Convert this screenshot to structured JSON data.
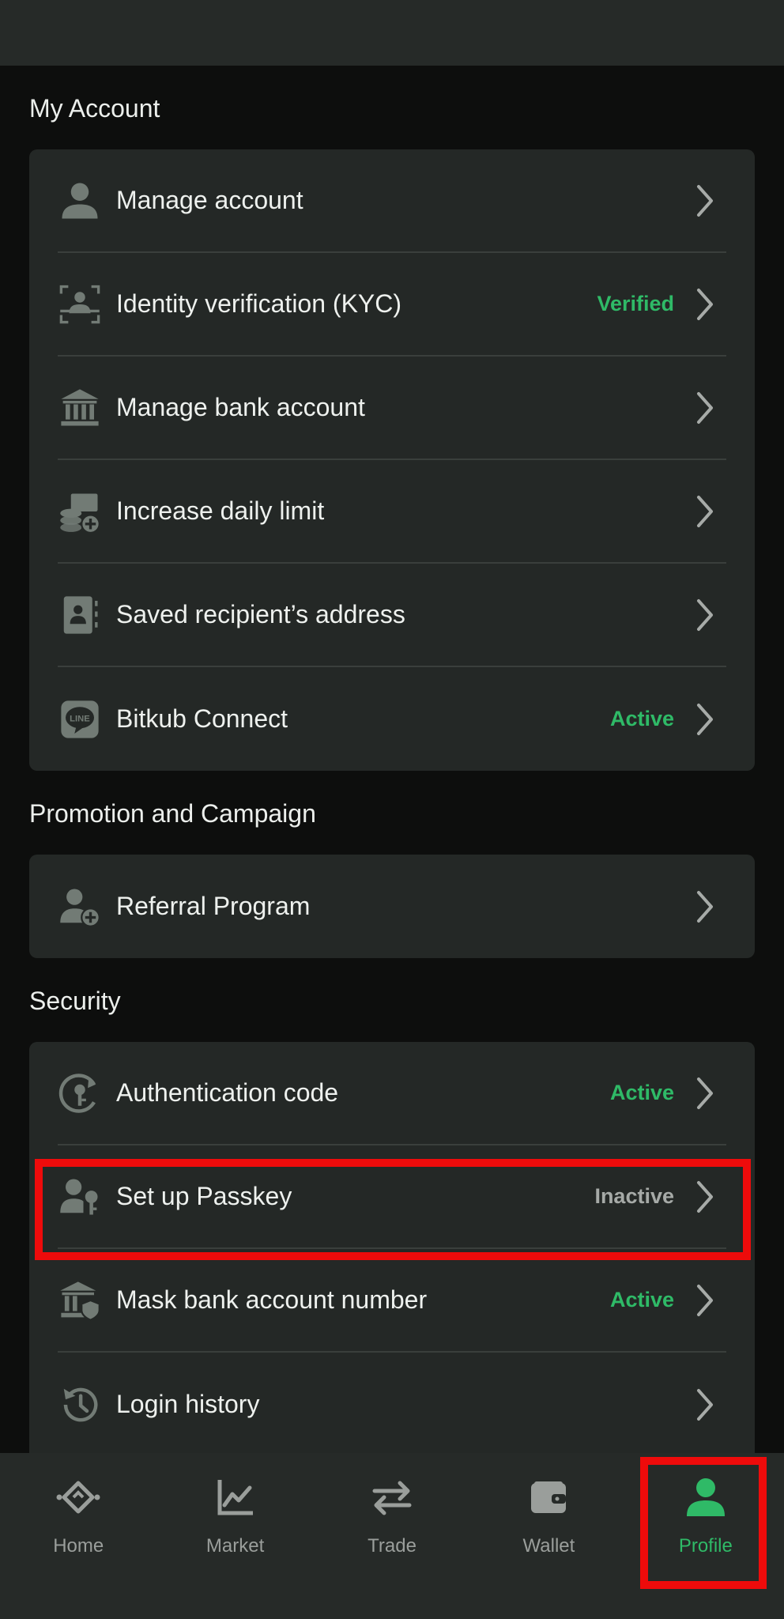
{
  "sections": {
    "my_account": {
      "title": "My Account",
      "items": [
        {
          "label": "Manage account",
          "status": ""
        },
        {
          "label": "Identity verification (KYC)",
          "status": "Verified"
        },
        {
          "label": "Manage bank account",
          "status": ""
        },
        {
          "label": "Increase daily limit",
          "status": ""
        },
        {
          "label": "Saved recipient’s address",
          "status": ""
        },
        {
          "label": "Bitkub Connect",
          "status": "Active"
        }
      ]
    },
    "promotion": {
      "title": "Promotion and Campaign",
      "items": [
        {
          "label": "Referral Program",
          "status": ""
        }
      ]
    },
    "security": {
      "title": "Security",
      "items": [
        {
          "label": "Authentication code",
          "status": "Active"
        },
        {
          "label": "Set up Passkey",
          "status": "Inactive"
        },
        {
          "label": "Mask bank account number",
          "status": "Active"
        },
        {
          "label": "Login history",
          "status": ""
        }
      ]
    }
  },
  "line_icon_text": "LINE",
  "nav": [
    {
      "label": "Home",
      "icon": "home-icon"
    },
    {
      "label": "Market",
      "icon": "market-chart-icon"
    },
    {
      "label": "Trade",
      "icon": "trade-arrows-icon"
    },
    {
      "label": "Wallet",
      "icon": "wallet-icon"
    },
    {
      "label": "Profile",
      "icon": "profile-icon",
      "active": true
    }
  ],
  "colors": {
    "background": "#0d0e0d",
    "card": "#242826",
    "active_green": "#2fba67",
    "inactive_gray": "#a6aaa7",
    "highlight_red": "#ee0b0b"
  }
}
